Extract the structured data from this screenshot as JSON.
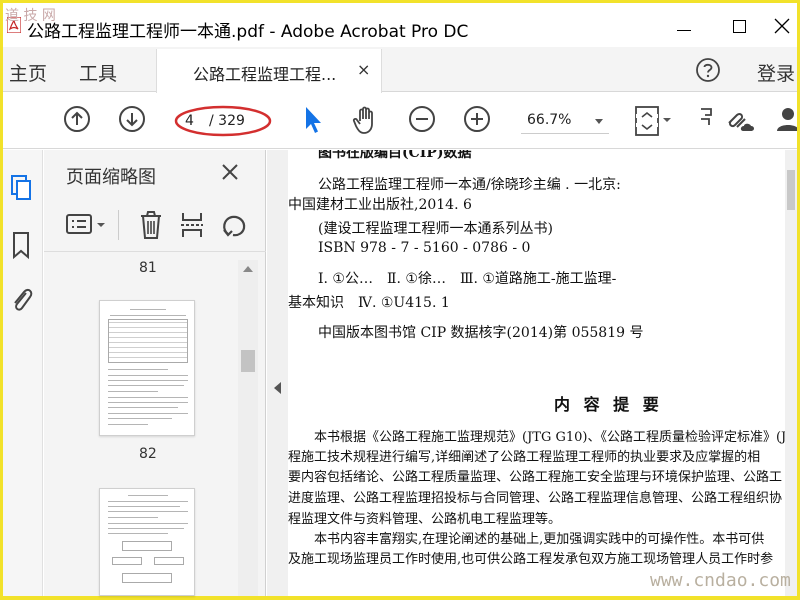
{
  "window": {
    "title": "公路工程监理工程师一本通.pdf - Adobe Acrobat Pro DC",
    "watermark_top": "道 技 网"
  },
  "colors": {
    "frame": "#f2e22a",
    "accent_blue": "#1473e6",
    "annotation_red": "#d32f2f"
  },
  "tabbar": {
    "home": "主页",
    "tools": "工具",
    "doc_tab": "公路工程监理工程...",
    "doc_tab_close": "×",
    "login": "登录"
  },
  "toolbar": {
    "page_current": "4",
    "page_total": "/ 329",
    "zoom": "66.7%"
  },
  "thumbnails": {
    "title": "页面缩略图",
    "pages": [
      "81",
      "82"
    ]
  },
  "document": {
    "lines": [
      "图书在版编目(CIP)数据",
      "公路工程监理工程师一本通/徐晓珍主编 . 一北京:",
      "中国建材工业出版社,2014. 6",
      "(建设工程监理工程师一本通系列丛书)",
      "ISBN 978 - 7 - 5160 - 0786 - 0",
      "Ⅰ. ①公…　Ⅱ. ①徐…　Ⅲ. ①道路施工-施工监理-",
      "基本知识　Ⅳ. ①U415. 1",
      "中国版本图书馆 CIP 数据核字(2014)第 055819 号"
    ],
    "heading": "内 容 提 要",
    "body": [
      "本书根据《公路工程施工监理规范》(JTG G10)、《公路工程质量检验评定标准》(JT",
      "程施工技术规程进行编写,详细阐述了公路工程监理工程师的执业要求及应掌握的相",
      "要内容包括绪论、公路工程质量监理、公路工程施工安全监理与环境保护监理、公路工",
      "进度监理、公路工程监理招投标与合同管理、公路工程监理信息管理、公路工程组织协",
      "程监理文件与资料管理、公路机电工程监理等。",
      "本书内容丰富翔实,在理论阐述的基础上,更加强调实践中的可操作性。本书可供",
      "及施工现场监理员工作时使用,也可供公路工程发承包双方施工现场管理人员工作时参"
    ],
    "watermark_bottom": "www.cndao.com"
  }
}
